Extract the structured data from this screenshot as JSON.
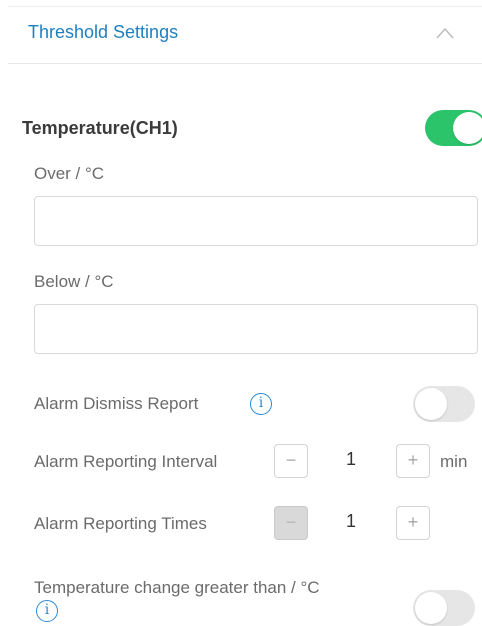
{
  "threshold": {
    "title": "Threshold Settings",
    "collapse_icon": "chevron-up-icon"
  },
  "temperature": {
    "title": "Temperature(CH1)",
    "enabled": true,
    "over_label": "Over / °C",
    "over_value": "",
    "below_label": "Below / °C",
    "below_value": "",
    "alarm_dismiss_label": "Alarm Dismiss Report",
    "alarm_dismiss_enabled": false,
    "interval_label": "Alarm Reporting Interval",
    "interval_value": "1",
    "interval_unit": "min",
    "times_label": "Alarm Reporting Times",
    "times_value": "1",
    "change_label": "Temperature change greater than / °C",
    "change_enabled": false
  },
  "icons": {
    "minus": "−",
    "plus": "+",
    "info": "i"
  },
  "colors": {
    "accent": "#1f80c0",
    "toggle_on": "#2cc46a",
    "toggle_off": "#e6e6e6"
  }
}
